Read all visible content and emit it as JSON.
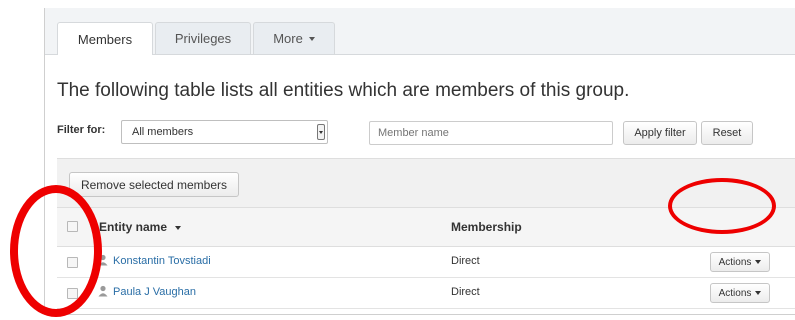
{
  "tabs": [
    {
      "label": "Members",
      "active": true
    },
    {
      "label": "Privileges",
      "active": false
    },
    {
      "label": "More",
      "active": false
    }
  ],
  "heading": "The following table lists all entities which are members of this group.",
  "filter": {
    "label": "Filter for:",
    "select_value": "All members",
    "name_placeholder": "Member name",
    "apply_label": "Apply filter",
    "reset_label": "Reset"
  },
  "toolbar": {
    "remove_label": "Remove selected members"
  },
  "table": {
    "columns": {
      "name": "Entity name",
      "membership": "Membership"
    },
    "rows": [
      {
        "name": "Konstantin Tovstiadi",
        "membership": "Direct",
        "action": "Actions"
      },
      {
        "name": "Paula J Vaughan",
        "membership": "Direct",
        "action": "Actions"
      }
    ]
  },
  "icons": {
    "person": "person-icon",
    "sort": "sort-caret-icon",
    "dropdown": "caret-down-icon"
  },
  "colors": {
    "link": "#2a6ea6",
    "annotation": "#ee0000",
    "tabbar": "#f2f4f6"
  }
}
